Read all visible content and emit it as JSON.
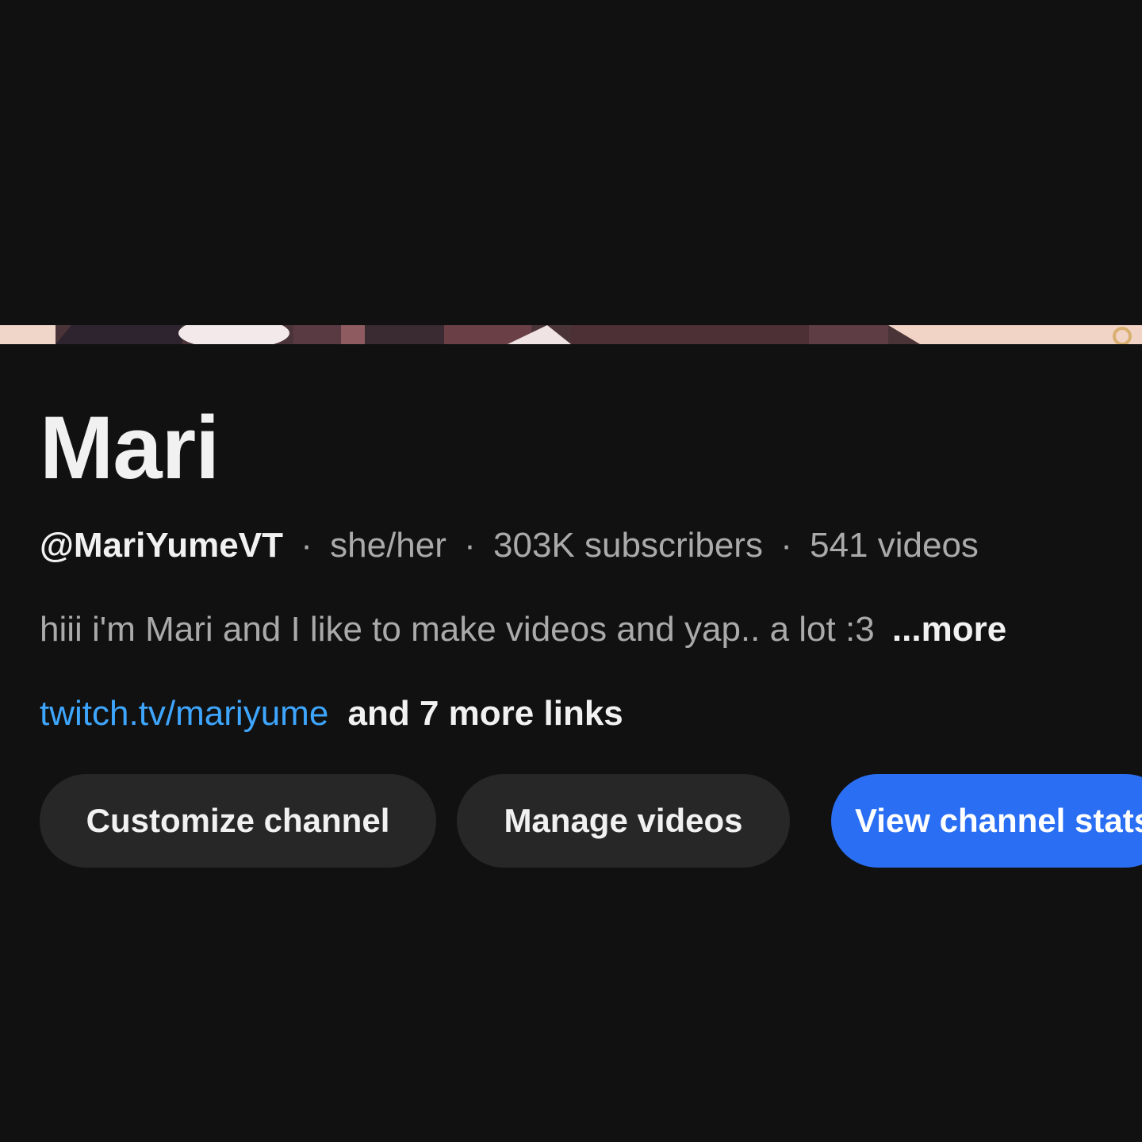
{
  "channel": {
    "name": "Mari",
    "handle": "@MariYumeVT",
    "pronouns": "she/her",
    "subscribers": "303K subscribers",
    "videos": "541 videos",
    "separator": "·",
    "description": "hiii i'm Mari and I like to make videos and yap.. a lot :3",
    "description_more": "...more",
    "primary_link": "twitch.tv/mariyume",
    "more_links": "and 7 more links"
  },
  "actions": {
    "customize_label": "Customize channel",
    "manage_label": "Manage videos",
    "stats_label": "View channel stats"
  },
  "colors": {
    "background": "#111111",
    "text_primary": "#f1f1f1",
    "text_secondary": "#aaaaaa",
    "link": "#3ea6ff",
    "button_secondary": "#272727",
    "button_primary": "#2a6ff3"
  }
}
